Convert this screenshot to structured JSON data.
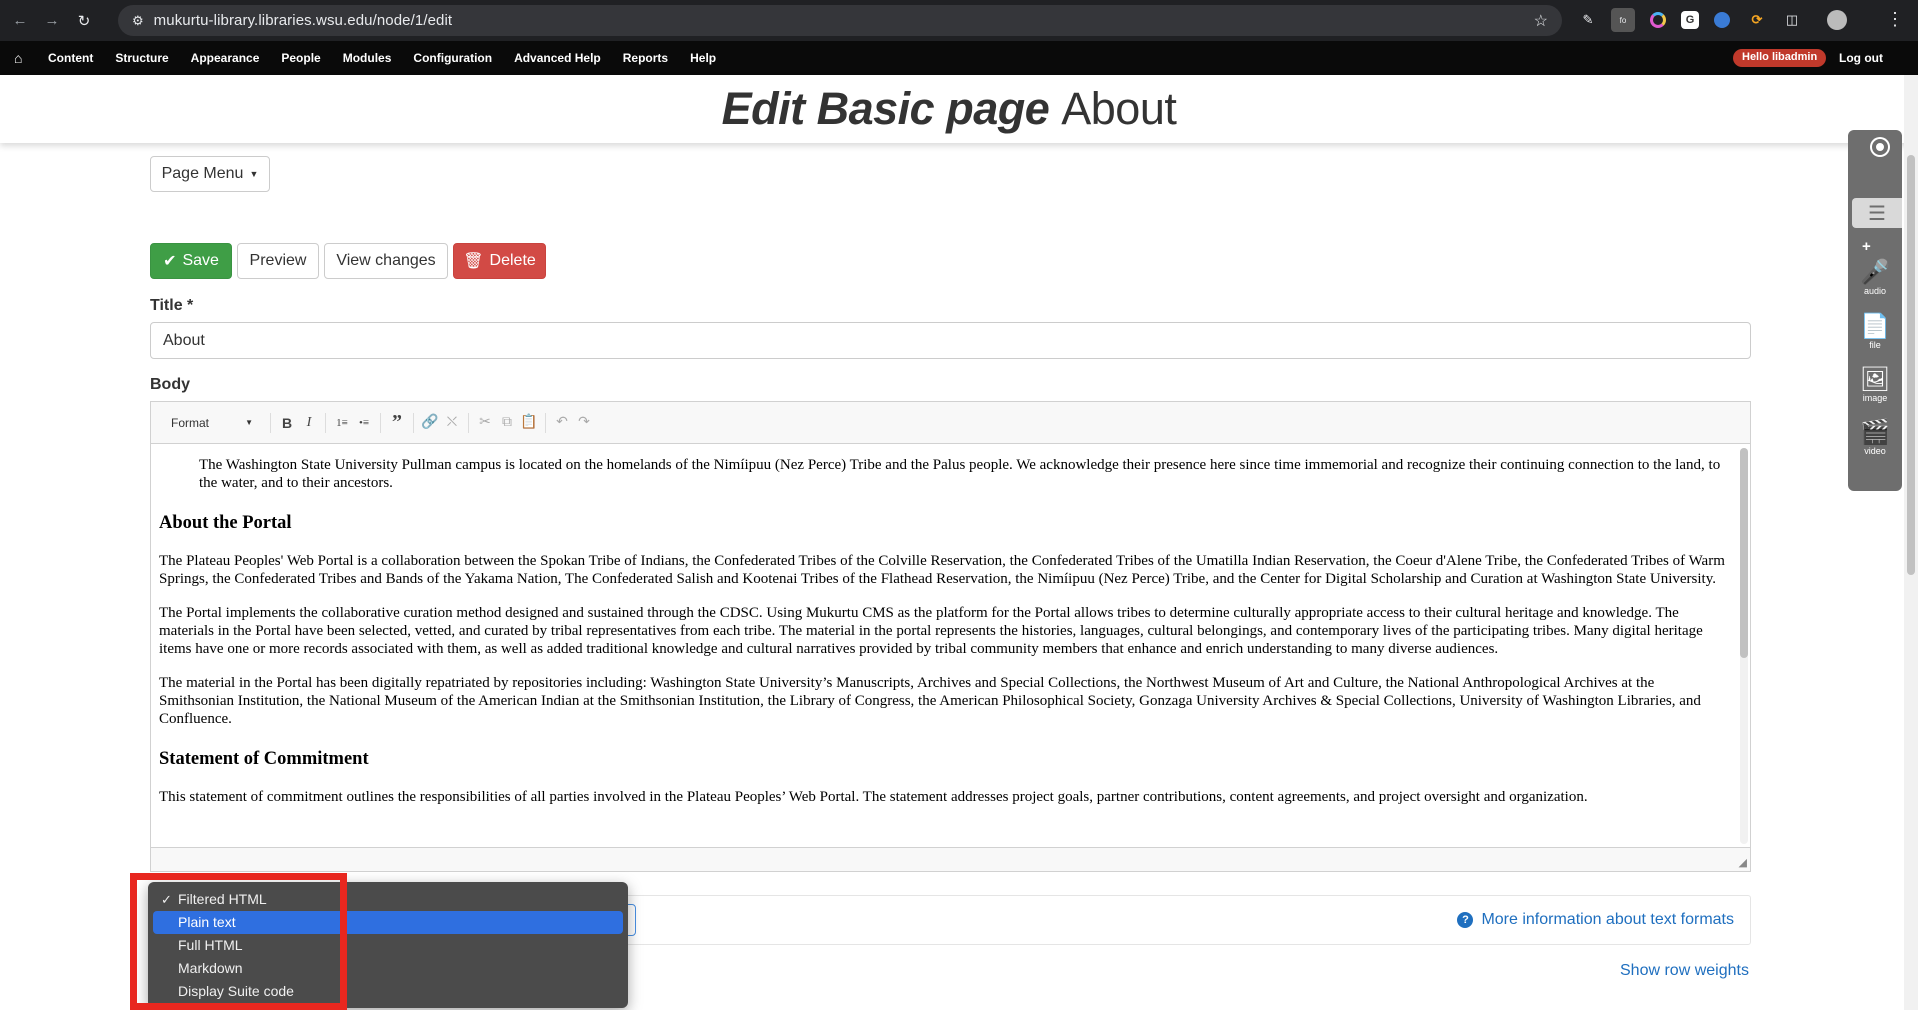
{
  "browser": {
    "url": "mukurtu-library.libraries.wsu.edu/node/1/edit"
  },
  "admin_menu": {
    "items": [
      "Content",
      "Structure",
      "Appearance",
      "People",
      "Modules",
      "Configuration",
      "Advanced Help",
      "Reports",
      "Help"
    ],
    "hello": "Hello libadmin",
    "logout": "Log out"
  },
  "page": {
    "title_strong": "Edit Basic page",
    "title_rest": "About"
  },
  "page_menu": {
    "label": "Page Menu"
  },
  "actions": {
    "save": "Save",
    "preview": "Preview",
    "view_changes": "View changes",
    "delete": "Delete"
  },
  "form": {
    "title_label": "Title *",
    "title_value": "About",
    "body_label": "Body"
  },
  "editor": {
    "format_label": "Format",
    "content": {
      "ack": "The Washington State University Pullman campus is located on the homelands of the Nimíipuu (Nez Perce) Tribe and the Palus people. We acknowledge their presence here since time immemorial and recognize their continuing connection to the land, to the water, and to their ancestors.",
      "h_about": "About the Portal",
      "p1": "The Plateau Peoples' Web Portal is a collaboration between the Spokan Tribe of Indians, the Confederated Tribes of the Colville Reservation, the Confederated Tribes of the Umatilla Indian Reservation, the Coeur d'Alene Tribe, the Confederated Tribes of Warm Springs, the Confederated Tribes and Bands of the Yakama Nation, The Confederated Salish and Kootenai Tribes of the Flathead Reservation, the Nimíipuu (Nez Perce) Tribe, and the Center for Digital Scholarship and Curation at Washington State University.",
      "p2": "The Portal implements the collaborative curation method designed and sustained through the CDSC. Using Mukurtu CMS as the platform for the Portal allows tribes to determine culturally appropriate access to their cultural heritage and knowledge. The materials in the Portal have been selected, vetted, and curated by tribal representatives from each tribe. The material in the portal represents the histories, languages, cultural belongings, and contemporary lives of the participating tribes. Many digital heritage items have one or more records associated with them, as well as added traditional knowledge and cultural narratives provided by tribal community members that enhance and enrich understanding to many diverse audiences.",
      "p3": "The material in the Portal has been digitally repatriated by repositories including: Washington State University’s Manuscripts, Archives and Special Collections, the Northwest Museum of Art and Culture, the National Anthropological Archives at the Smithsonian Institution, the National Museum of the American Indian at the Smithsonian Institution, the Library of Congress, the American Philosophical Society, Gonzaga University Archives & Special Collections, University of Washington Libraries, and Confluence.",
      "h_commit": "Statement of Commitment",
      "p4": "This statement of commitment outlines the responsibilities of all parties involved in the Plateau Peoples’ Web Portal. The statement addresses project goals, partner contributions, content agreements, and project oversight and organization."
    }
  },
  "text_format": {
    "options": [
      "Filtered HTML",
      "Plain text",
      "Full HTML",
      "Markdown",
      "Display Suite code"
    ],
    "checked_option": "Filtered HTML",
    "highlighted_option": "Plain text",
    "more_info": "More information about text formats",
    "show_row_weights": "Show row weights"
  },
  "media_panel": {
    "tools": [
      "audio",
      "file",
      "image",
      "video"
    ]
  },
  "colors": {
    "save": "#3f9e46",
    "delete": "#d24a45",
    "link": "#1f6fbf",
    "highlight": "#2f6fe0",
    "annotation": "#e8271f"
  }
}
